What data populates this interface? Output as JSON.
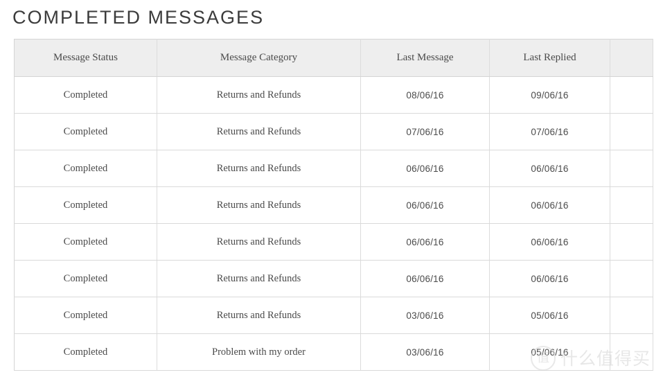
{
  "page": {
    "title": "COMPLETED MESSAGES"
  },
  "table": {
    "headers": [
      "Message Status",
      "Message Category",
      "Last Message",
      "Last Replied",
      ""
    ],
    "rows": [
      {
        "status": "Completed",
        "category": "Returns and Refunds",
        "last_message": "08/06/16",
        "last_replied": "09/06/16",
        "actions": ""
      },
      {
        "status": "Completed",
        "category": "Returns and Refunds",
        "last_message": "07/06/16",
        "last_replied": "07/06/16",
        "actions": ""
      },
      {
        "status": "Completed",
        "category": "Returns and Refunds",
        "last_message": "06/06/16",
        "last_replied": "06/06/16",
        "actions": ""
      },
      {
        "status": "Completed",
        "category": "Returns and Refunds",
        "last_message": "06/06/16",
        "last_replied": "06/06/16",
        "actions": ""
      },
      {
        "status": "Completed",
        "category": "Returns and Refunds",
        "last_message": "06/06/16",
        "last_replied": "06/06/16",
        "actions": ""
      },
      {
        "status": "Completed",
        "category": "Returns and Refunds",
        "last_message": "06/06/16",
        "last_replied": "06/06/16",
        "actions": ""
      },
      {
        "status": "Completed",
        "category": "Returns and Refunds",
        "last_message": "03/06/16",
        "last_replied": "05/06/16",
        "actions": ""
      },
      {
        "status": "Completed",
        "category": "Problem with my order",
        "last_message": "03/06/16",
        "last_replied": "05/06/16",
        "actions": ""
      }
    ]
  },
  "watermark": {
    "badge": "值",
    "text": "什么值得买"
  },
  "colors": {
    "title_text": "#3b3b3b",
    "header_background": "#eeeeee",
    "border": "#d9d9d9",
    "cell_text": "#4a4a4a",
    "watermark": "#d4d4d4"
  }
}
